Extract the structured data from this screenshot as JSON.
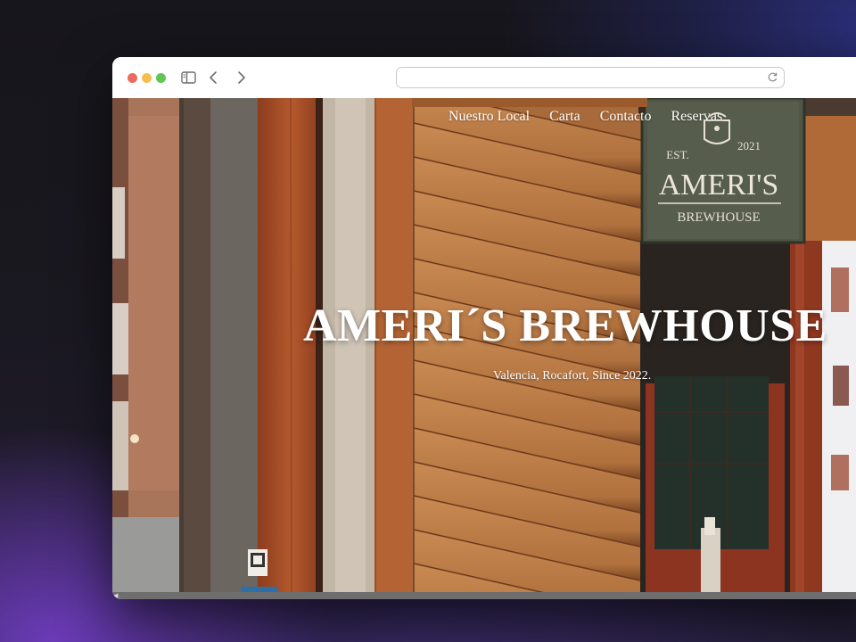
{
  "browser": {
    "url": "",
    "icons": [
      "sidebar-icon",
      "back-icon",
      "forward-icon",
      "reload-icon"
    ]
  },
  "site": {
    "nav": [
      {
        "label": "Nuestro Local"
      },
      {
        "label": "Carta"
      },
      {
        "label": "Contacto"
      },
      {
        "label": "Reservas"
      }
    ],
    "hero": {
      "title": "AMERI´S BREWHOUSE",
      "subtitle": "Valencia, Rocafort, Since 2022."
    },
    "sign": {
      "est": "EST.",
      "year": "2021",
      "name": "AMERI'S",
      "tagline": "BREWHOUSE"
    }
  },
  "colors": {
    "wood": "#b06a38",
    "sign_bg": "#4f5645",
    "accent_red": "#9a3a22",
    "traffic_red": "#ed6a5e",
    "traffic_yellow": "#f4bf4f",
    "traffic_green": "#61c554"
  }
}
